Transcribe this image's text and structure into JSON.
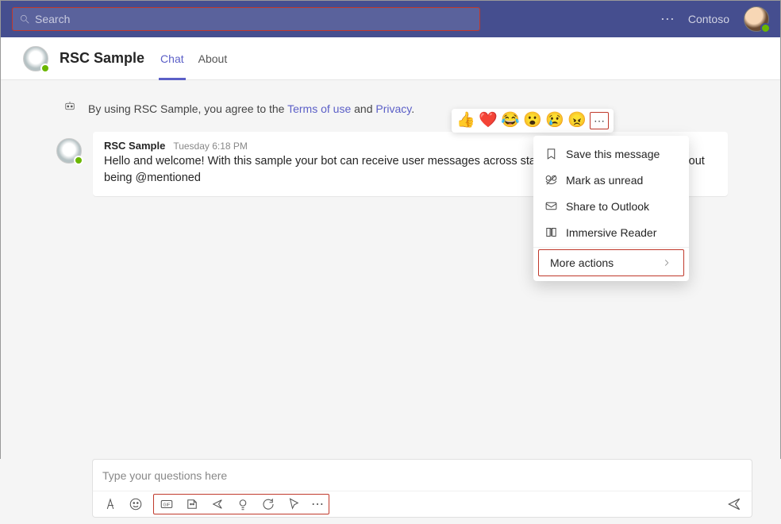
{
  "topbar": {
    "search_placeholder": "Search",
    "org_name": "Contoso"
  },
  "header": {
    "title": "RSC Sample",
    "tabs": [
      {
        "label": "Chat",
        "active": true
      },
      {
        "label": "About",
        "active": false
      }
    ]
  },
  "notice": {
    "prefix": "By using RSC Sample, you agree to the ",
    "terms_label": "Terms of use",
    "and": " and ",
    "privacy_label": "Privacy",
    "suffix": "."
  },
  "message": {
    "sender": "RSC Sample",
    "timestamp": "Tuesday 6:18 PM",
    "text": "Hello and welcome! With this sample your bot can receive user messages across standard channels in a team without being @mentioned"
  },
  "reactions": [
    "👍",
    "❤️",
    "😂",
    "😮",
    "😢",
    "😠"
  ],
  "context_menu": {
    "items": [
      {
        "label": "Save this message",
        "icon": "bookmark"
      },
      {
        "label": "Mark as unread",
        "icon": "unread"
      },
      {
        "label": "Share to Outlook",
        "icon": "mail"
      },
      {
        "label": "Immersive Reader",
        "icon": "reader"
      }
    ],
    "more_label": "More actions"
  },
  "compose": {
    "placeholder": "Type your questions here"
  }
}
